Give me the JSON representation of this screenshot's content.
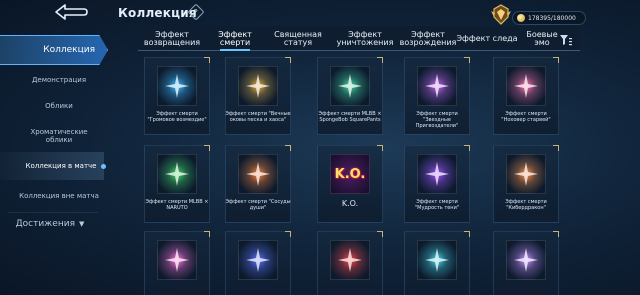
{
  "header": {
    "title": "Коллекция",
    "help_glyph": "?",
    "currency_value": "178395/180000"
  },
  "sidebar": {
    "main": "Коллекция",
    "items": [
      {
        "label": "Демонстрация"
      },
      {
        "label": "Облики"
      },
      {
        "label": "Хроматические облики"
      },
      {
        "label": "Коллекция в матче"
      },
      {
        "label": "Коллекция вне матча"
      }
    ],
    "group": "Достижения"
  },
  "tabs": [
    {
      "label": "Эффект возвращения"
    },
    {
      "label": "Эффект смерти"
    },
    {
      "label": "Священная статуя"
    },
    {
      "label": "Эффект уничтожения"
    },
    {
      "label": "Эффект возрождения"
    },
    {
      "label": "Эффект следа"
    },
    {
      "label": "Боевые эмо"
    }
  ],
  "cards": [
    {
      "label": "Эффект смерти \"Громовое возмездие\"",
      "accent": "#38b6ff"
    },
    {
      "label": "Эффект смерти \"Вечные оковы песка и хаоса\"",
      "accent": "#e0a637"
    },
    {
      "label": "Эффект смерти MLBB × SpongeBob SquarePants",
      "accent": "#3fd39a"
    },
    {
      "label": "Эффект смерти \"Звездные Пригвоздатели\"",
      "accent": "#c35cf0"
    },
    {
      "label": "Эффект смерти \"Ноховер старвей\"",
      "accent": "#ff6aa8"
    },
    {
      "label": "Эффект смерти MLBB × NARUTO",
      "accent": "#3fd45e"
    },
    {
      "label": "Эффект смерти \"Сосуды души\"",
      "accent": "#ff7a2e"
    },
    {
      "label": "K.O.",
      "accent": "#ff4d6d",
      "glyph": "K.O."
    },
    {
      "label": "Эффект смерти \"Мудрость тени\"",
      "accent": "#a148ff"
    },
    {
      "label": "Эффект смерти \"Кибердракон\"",
      "accent": "#ff8a3b"
    },
    {
      "label": "",
      "accent": "#ff6ad6"
    },
    {
      "label": "",
      "accent": "#5b6fff"
    },
    {
      "label": "",
      "accent": "#ff4040"
    },
    {
      "label": "",
      "accent": "#3fd3e0"
    },
    {
      "label": "",
      "accent": "#c78cff"
    }
  ]
}
